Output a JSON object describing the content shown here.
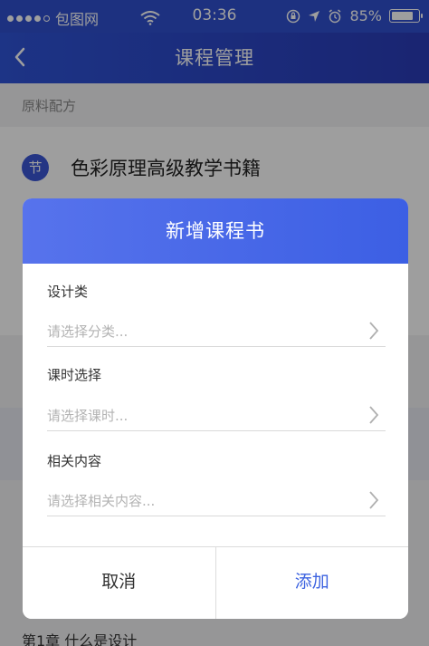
{
  "status_bar": {
    "carrier": "包图网",
    "time": "03:36",
    "battery": "85%",
    "battery_level": 0.85
  },
  "nav": {
    "title": "课程管理"
  },
  "background": {
    "section_label": "原料配方",
    "badge": "节",
    "course_title": "色彩原理高级教学书籍",
    "bottom_text": "第1章 什么是设计"
  },
  "dialog": {
    "title": "新增课程书",
    "fields": [
      {
        "label": "设计类",
        "placeholder": "请选择分类..."
      },
      {
        "label": "课时选择",
        "placeholder": "请选择课时..."
      },
      {
        "label": "相关内容",
        "placeholder": "请选择相关内容..."
      }
    ],
    "cancel_label": "取消",
    "add_label": "添加"
  },
  "colors": {
    "accent": "#3d63e0",
    "header_start": "#5773ec",
    "header_end": "#3c5fe4",
    "nav": "#2f4fcf"
  }
}
